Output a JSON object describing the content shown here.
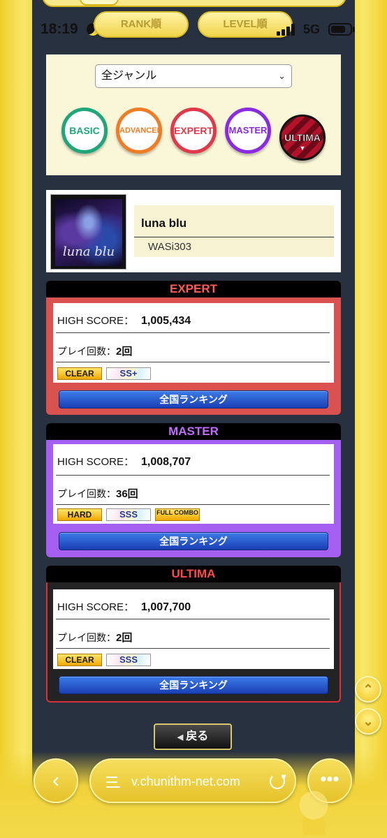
{
  "status_bar": {
    "time": "18:19",
    "network": "5G"
  },
  "sort_tabs": [
    "RANK順",
    "LEVEL順"
  ],
  "filter": {
    "genre_selected": "全ジャンル",
    "difficulties": [
      {
        "label": "BASIC",
        "color": "#1fa67a"
      },
      {
        "label": "ADVANCED",
        "color": "#f07c24"
      },
      {
        "label": "EXPERT",
        "color": "#e03a4a"
      },
      {
        "label": "MASTER",
        "color": "#8a2be2"
      },
      {
        "label": "ULTIMA",
        "color": "#b3122a"
      }
    ]
  },
  "song": {
    "jacket_text": "luna blu",
    "title": "luna blu",
    "artist": "WASi303"
  },
  "results": [
    {
      "difficulty": "EXPERT",
      "title_color": "#ff5a5a",
      "frame_color": "#d9524f",
      "high_score_label": "HIGH SCORE：",
      "high_score": "1,005,434",
      "play_count_label": "プレイ回数：",
      "play_count": "2回",
      "lamps": [
        "CLEAR",
        "SS+"
      ],
      "ranking_button": "全国ランキング"
    },
    {
      "difficulty": "MASTER",
      "title_color": "#c06cff",
      "frame_color": "#a45ef0",
      "high_score_label": "HIGH SCORE：",
      "high_score": "1,008,707",
      "play_count_label": "プレイ回数：",
      "play_count": "36回",
      "lamps": [
        "HARD",
        "SSS",
        "FULL COMBO"
      ],
      "ranking_button": "全国ランキング"
    },
    {
      "difficulty": "ULTIMA",
      "title_color": "#ff4a4a",
      "frame_color": "#232323",
      "high_score_label": "HIGH SCORE：",
      "high_score": "1,007,700",
      "play_count_label": "プレイ回数：",
      "play_count": "2回",
      "lamps": [
        "CLEAR",
        "SSS"
      ],
      "ranking_button": "全国ランキング"
    }
  ],
  "back_button": "戻る",
  "browser": {
    "url": "v.chunithm-net.com"
  }
}
